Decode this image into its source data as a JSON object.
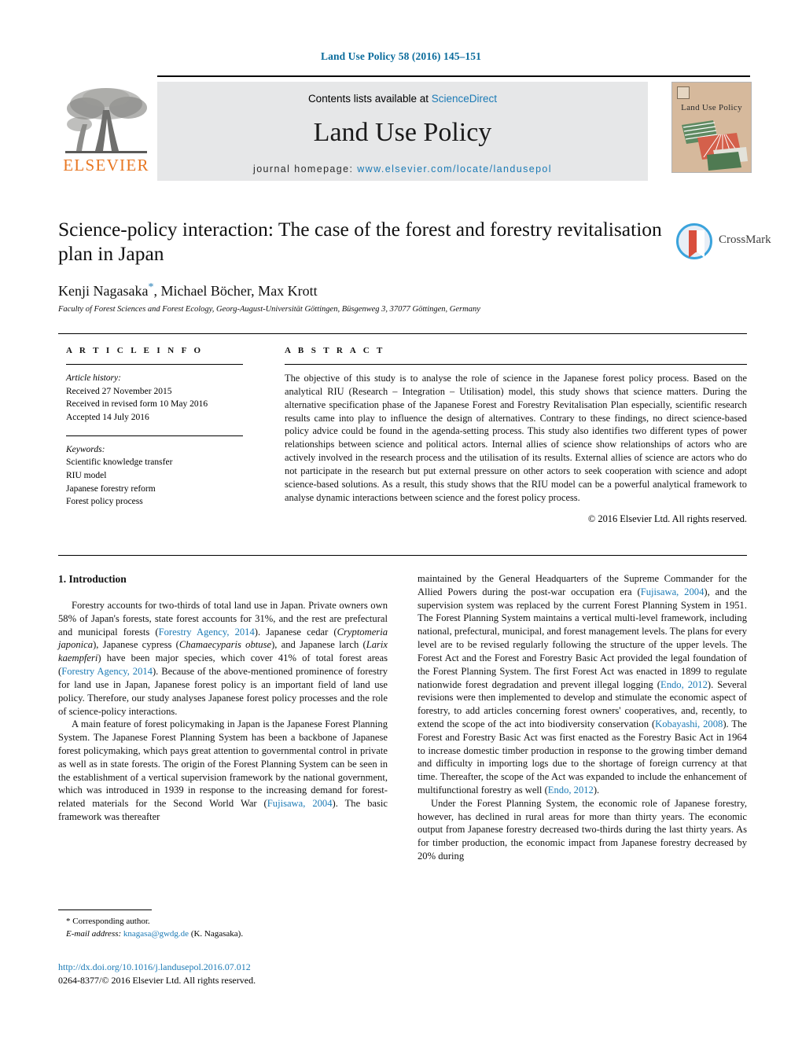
{
  "running_head": "Land Use Policy 58 (2016) 145–151",
  "masthead": {
    "contents_prefix": "Contents lists available at ",
    "sciencedirect": "ScienceDirect",
    "journal_title": "Land Use Policy",
    "homepage_prefix": "journal homepage: ",
    "homepage_url": "www.elsevier.com/locate/landusepol",
    "publisher_logo_text": "ELSEVIER",
    "publisher_logo_name": "elsevier-tree-logo",
    "cover_title": "Land Use Policy"
  },
  "article": {
    "title": "Science-policy interaction: The case of the forest and forestry revitalisation plan in Japan",
    "authors": "Kenji Nagasaka, Michael Böcher, Max Krott",
    "author_star": "*",
    "affiliation": "Faculty of Forest Sciences and Forest Ecology, Georg-August-Universität Göttingen, Büsgenweg 3, 37077 Göttingen, Germany",
    "crossmark_label": "CrossMark"
  },
  "article_info": {
    "heading": "A R T I C L E   I N F O",
    "history_label": "Article history:",
    "history": [
      "Received 27 November 2015",
      "Received in revised form 10 May 2016",
      "Accepted 14 July 2016"
    ],
    "keywords_label": "Keywords:",
    "keywords": [
      "Scientific knowledge transfer",
      "RIU model",
      "Japanese forestry reform",
      "Forest policy process"
    ]
  },
  "abstract": {
    "heading": "A B S T R A C T",
    "text": "The objective of this study is to analyse the role of science in the Japanese forest policy process. Based on the analytical RIU (Research – Integration – Utilisation) model, this study shows that science matters. During the alternative specification phase of the Japanese Forest and Forestry Revitalisation Plan especially, scientific research results came into play to influence the design of alternatives. Contrary to these findings, no direct science-based policy advice could be found in the agenda-setting process. This study also identifies two different types of power relationships between science and political actors. Internal allies of science show relationships of actors who are actively involved in the research process and the utilisation of its results. External allies of science are actors who do not participate in the research but put external pressure on other actors to seek cooperation with science and adopt science-based solutions. As a result, this study shows that the RIU model can be a powerful analytical framework to analyse dynamic interactions between science and the forest policy process.",
    "copyright": "© 2016 Elsevier Ltd. All rights reserved."
  },
  "body": {
    "section_heading": "1. Introduction",
    "left_paragraphs": [
      "Forestry accounts for two-thirds of total land use in Japan. Private owners own 58% of Japan's forests, state forest accounts for 31%, and the rest are prefectural and municipal forests (Forestry Agency, 2014). Japanese cedar (Cryptomeria japonica), Japanese cypress (Chamaecyparis obtuse), and Japanese larch (Larix kaempferi) have been major species, which cover 41% of total forest areas (Forestry Agency, 2014). Because of the above-mentioned prominence of forestry for land use in Japan, Japanese forest policy is an important field of land use policy. Therefore, our study analyses Japanese forest policy processes and the role of science-policy interactions.",
      "A main feature of forest policymaking in Japan is the Japanese Forest Planning System. The Japanese Forest Planning System has been a backbone of Japanese forest policymaking, which pays great attention to governmental control in private as well as in state forests. The origin of the Forest Planning System can be seen in the establishment of a vertical supervision framework by the national government, which was introduced in 1939 in response to the increasing demand for forest-related materials for the Second World War (Fujisawa, 2004). The basic framework was thereafter"
    ],
    "right_paragraphs": [
      "maintained by the General Headquarters of the Supreme Commander for the Allied Powers during the post-war occupation era (Fujisawa, 2004), and the supervision system was replaced by the current Forest Planning System in 1951. The Forest Planning System maintains a vertical multi-level framework, including national, prefectural, municipal, and forest management levels. The plans for every level are to be revised regularly following the structure of the upper levels. The Forest Act and the Forest and Forestry Basic Act provided the legal foundation of the Forest Planning System. The first Forest Act was enacted in 1899 to regulate nationwide forest degradation and prevent illegal logging (Endo, 2012). Several revisions were then implemented to develop and stimulate the economic aspect of forestry, to add articles concerning forest owners' cooperatives, and, recently, to extend the scope of the act into biodiversity conservation (Kobayashi, 2008). The Forest and Forestry Basic Act was first enacted as the Forestry Basic Act in 1964 to increase domestic timber production in response to the growing timber demand and difficulty in importing logs due to the shortage of foreign currency at that time. Thereafter, the scope of the Act was expanded to include the enhancement of multifunctional forestry as well (Endo, 2012).",
      "Under the Forest Planning System, the economic role of Japanese forestry, however, has declined in rural areas for more than thirty years. The economic output from Japanese forestry decreased two-thirds during the last thirty years. As for timber production, the economic impact from Japanese forestry decreased by 20% during"
    ]
  },
  "footnote": {
    "star": "*",
    "corresponding": "Corresponding author.",
    "email_label": "E-mail address:",
    "email": "knagasa@gwdg.de",
    "email_suffix": "(K. Nagasaka)."
  },
  "footer": {
    "doi": "http://dx.doi.org/10.1016/j.landusepol.2016.07.012",
    "issn_line": "0264-8377/© 2016 Elsevier Ltd. All rights reserved."
  },
  "colors": {
    "link": "#1b7ab5",
    "elsevier_orange": "#e87722",
    "band_gray": "#e6e7e8"
  }
}
